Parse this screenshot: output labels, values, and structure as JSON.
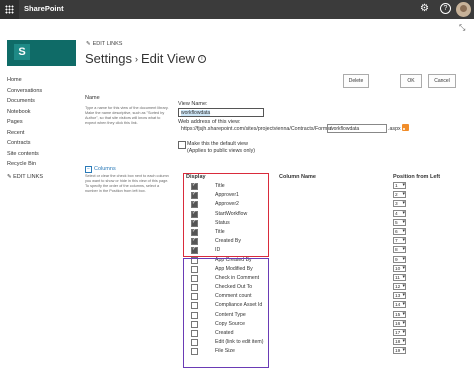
{
  "suite_bar": {
    "app_name": "SharePoint"
  },
  "header": {
    "edit_links_label": "EDIT LINKS",
    "title_part1": "Settings",
    "separator": "›",
    "title_part2": "Edit View",
    "info_glyph": "i"
  },
  "buttons": {
    "delete": "Delete",
    "ok": "OK",
    "cancel": "Cancel"
  },
  "nav": {
    "items": [
      "Home",
      "Conversations",
      "Documents",
      "Notebook",
      "Pages",
      "Recent",
      "Contracts",
      "Site contents",
      "Recycle Bin"
    ],
    "edit_links": "EDIT LINKS"
  },
  "name_section": {
    "heading": "Name",
    "description": "Type a name for this view of the document library. Make the name descriptive, such as \"Sorted by Author\", so that site visitors will know what to expect when they click this link.",
    "view_name_label": "View Name:",
    "view_name_value": "workflowdata",
    "web_address_label": "Web address of this view:",
    "url_prefix": "https://fjsjh.sharepoint.com/sites/projectvienna/Contracts/Forms/",
    "url_value": "workflowdata",
    "url_suffix": ".aspx",
    "default_view_label": "Make this the default view",
    "default_view_note": "(Applies to public views only)",
    "default_view_checked": false
  },
  "columns_section": {
    "heading": "Columns",
    "collapse_glyph": "−",
    "description": "Select or clear the check box next to each column you want to show or hide in this view of this page. To specify the order of the columns, select a number in the Position from left box.",
    "headers": {
      "display": "Display",
      "column_name": "Column Name",
      "position": "Position from Left"
    },
    "rows": [
      {
        "name": "Title",
        "checked": true,
        "position": "1"
      },
      {
        "name": "Approver1",
        "checked": true,
        "position": "2"
      },
      {
        "name": "Approver2",
        "checked": true,
        "position": "3"
      },
      {
        "name": "StartWorkflow",
        "checked": true,
        "position": "4"
      },
      {
        "name": "Status",
        "checked": true,
        "position": "5"
      },
      {
        "name": "Title",
        "checked": true,
        "position": "6"
      },
      {
        "name": "Created By",
        "checked": true,
        "position": "7"
      },
      {
        "name": "ID",
        "checked": true,
        "position": "8"
      },
      {
        "name": "App Created By",
        "checked": false,
        "position": "9"
      },
      {
        "name": "App Modified By",
        "checked": false,
        "position": "10"
      },
      {
        "name": "Check in Comment",
        "checked": false,
        "position": "11"
      },
      {
        "name": "Checked Out To",
        "checked": false,
        "position": "12"
      },
      {
        "name": "Comment count",
        "checked": false,
        "position": "13"
      },
      {
        "name": "Compliance Asset Id",
        "checked": false,
        "position": "14"
      },
      {
        "name": "Content Type",
        "checked": false,
        "position": "15"
      },
      {
        "name": "Copy Source",
        "checked": false,
        "position": "16"
      },
      {
        "name": "Created",
        "checked": false,
        "position": "17"
      },
      {
        "name": "Edit (link to edit item)",
        "checked": false,
        "position": "18"
      },
      {
        "name": "File Size",
        "checked": false,
        "position": "19"
      }
    ]
  },
  "colors": {
    "suite_bar": "#3b3b3b",
    "site_logo": "#0f6b67",
    "highlight_red": "#d92b3b",
    "highlight_purple": "#6a3bb5",
    "link_blue": "#2a7ab8"
  },
  "icons": [
    "waffle-icon",
    "gear-icon",
    "help-icon",
    "avatar",
    "focus-mode-icon",
    "pencil-icon",
    "info-icon",
    "rss-icon"
  ]
}
